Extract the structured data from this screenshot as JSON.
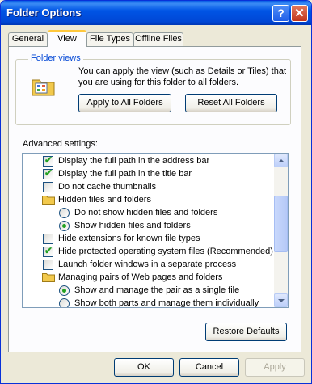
{
  "window": {
    "title": "Folder Options"
  },
  "tabs": [
    {
      "label": "General"
    },
    {
      "label": "View"
    },
    {
      "label": "File Types"
    },
    {
      "label": "Offline Files"
    }
  ],
  "folder_views": {
    "group_label": "Folder views",
    "description": "You can apply the view (such as Details or Tiles) that you are using for this folder to all folders.",
    "apply_label": "Apply to All Folders",
    "reset_label": "Reset All Folders"
  },
  "advanced": {
    "label": "Advanced settings:",
    "items": [
      {
        "kind": "checkbox",
        "level": 1,
        "checked": true,
        "label": "Display the full path in the address bar"
      },
      {
        "kind": "checkbox",
        "level": 1,
        "checked": true,
        "label": "Display the full path in the title bar"
      },
      {
        "kind": "checkbox",
        "level": 1,
        "checked": false,
        "label": "Do not cache thumbnails"
      },
      {
        "kind": "folder",
        "level": 1,
        "label": "Hidden files and folders"
      },
      {
        "kind": "radio",
        "level": 2,
        "checked": false,
        "label": "Do not show hidden files and folders"
      },
      {
        "kind": "radio",
        "level": 2,
        "checked": true,
        "label": "Show hidden files and folders"
      },
      {
        "kind": "checkbox",
        "level": 1,
        "checked": false,
        "label": "Hide extensions for known file types"
      },
      {
        "kind": "checkbox",
        "level": 1,
        "checked": true,
        "label": "Hide protected operating system files (Recommended)"
      },
      {
        "kind": "checkbox",
        "level": 1,
        "checked": false,
        "label": "Launch folder windows in a separate process"
      },
      {
        "kind": "folder",
        "level": 1,
        "label": "Managing pairs of Web pages and folders"
      },
      {
        "kind": "radio",
        "level": 2,
        "checked": true,
        "label": "Show and manage the pair as a single file"
      },
      {
        "kind": "radio",
        "level": 2,
        "checked": false,
        "label": "Show both parts and manage them individually"
      }
    ]
  },
  "buttons": {
    "restore_label": "Restore Defaults",
    "ok_label": "OK",
    "cancel_label": "Cancel",
    "apply_label": "Apply"
  }
}
